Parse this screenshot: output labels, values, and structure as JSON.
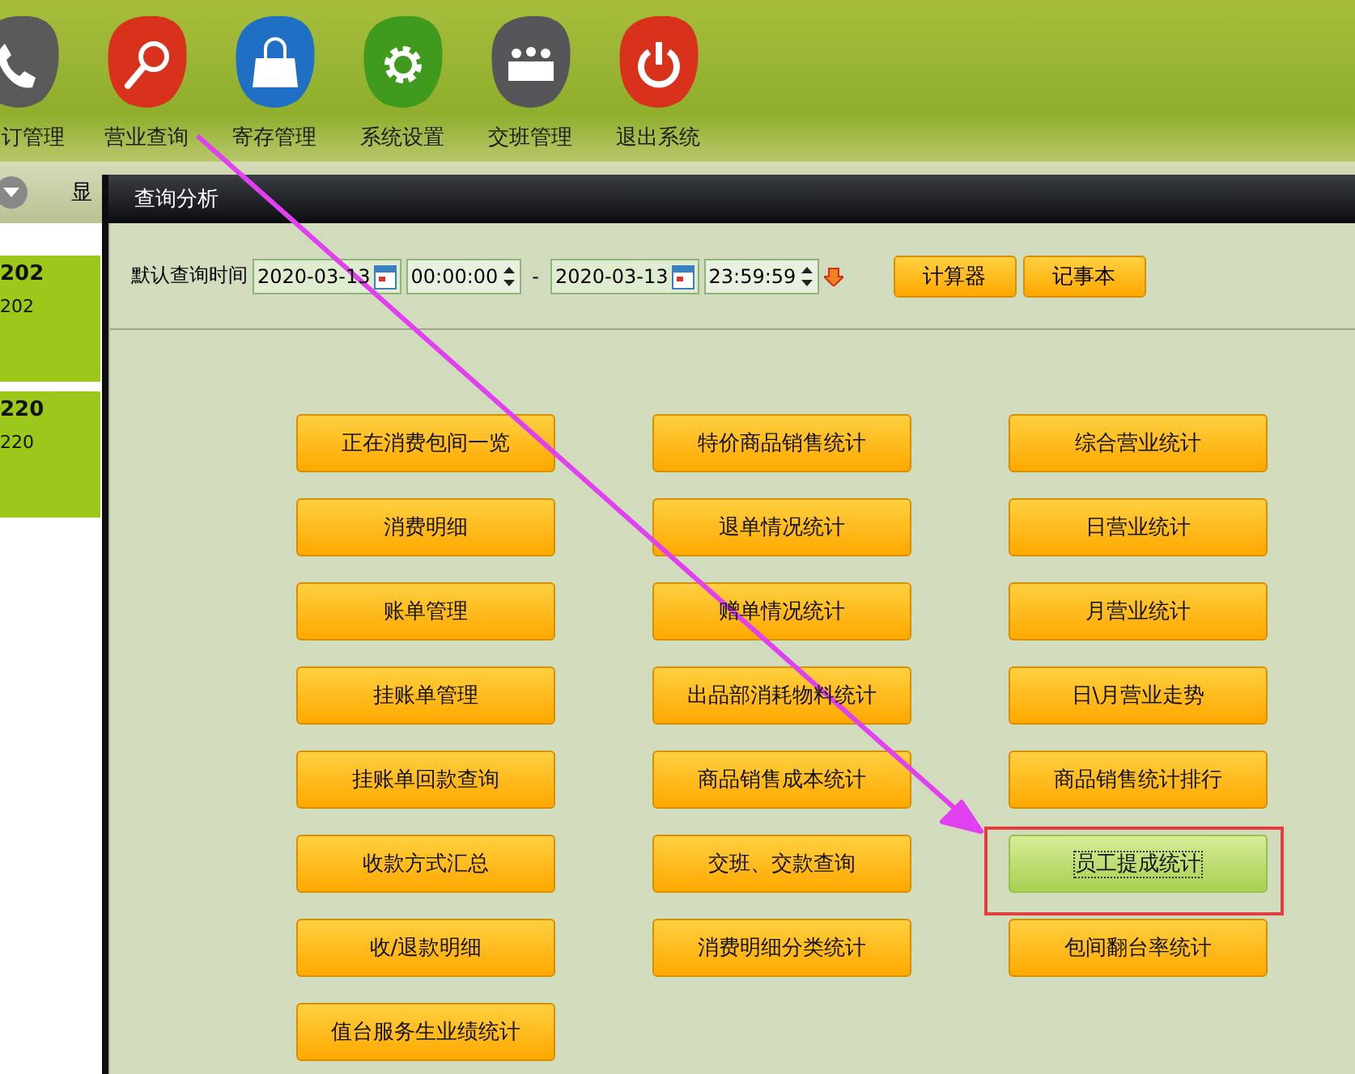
{
  "toolbar": {
    "items": [
      {
        "label": "订管理",
        "kind": "phone",
        "color": "#5a5a5a"
      },
      {
        "label": "营业查询",
        "kind": "search",
        "color": "#d8321c"
      },
      {
        "label": "寄存管理",
        "kind": "bag",
        "color": "#1f6fc4"
      },
      {
        "label": "系统设置",
        "kind": "gear",
        "color": "#3f9a1e"
      },
      {
        "label": "交班管理",
        "kind": "group",
        "color": "#55555a"
      },
      {
        "label": "退出系统",
        "kind": "power",
        "color": "#d8321c"
      }
    ]
  },
  "second_bar": {
    "label": "显"
  },
  "rooms": [
    {
      "number": "202",
      "name": "202"
    },
    {
      "number": "220",
      "name": "220"
    }
  ],
  "dialog": {
    "title": "查询分析",
    "query": {
      "label": "默认查询时间",
      "start_date": "2020-03-13",
      "start_time": "00:00:00",
      "separator": "-",
      "end_date": "2020-03-13",
      "end_time": "23:59:59"
    },
    "tools": [
      "计算器",
      "记事本"
    ],
    "reports": [
      {
        "label": "正在消费包间一览",
        "selected": false
      },
      {
        "label": "特价商品销售统计",
        "selected": false
      },
      {
        "label": "综合营业统计",
        "selected": false
      },
      {
        "label": "消费明细",
        "selected": false
      },
      {
        "label": "退单情况统计",
        "selected": false
      },
      {
        "label": "日营业统计",
        "selected": false
      },
      {
        "label": "账单管理",
        "selected": false
      },
      {
        "label": "赠单情况统计",
        "selected": false
      },
      {
        "label": "月营业统计",
        "selected": false
      },
      {
        "label": "挂账单管理",
        "selected": false
      },
      {
        "label": "出品部消耗物料统计",
        "selected": false
      },
      {
        "label": "日\\月营业走势",
        "selected": false
      },
      {
        "label": "挂账单回款查询",
        "selected": false
      },
      {
        "label": "商品销售成本统计",
        "selected": false
      },
      {
        "label": "商品销售统计排行",
        "selected": false
      },
      {
        "label": "收款方式汇总",
        "selected": false
      },
      {
        "label": "交班、交款查询",
        "selected": false
      },
      {
        "label": "员工提成统计",
        "selected": true
      },
      {
        "label": "收/退款明细",
        "selected": false
      },
      {
        "label": "消费明细分类统计",
        "selected": false
      },
      {
        "label": "包间翻台率统计",
        "selected": false
      },
      {
        "label": "值台服务生业绩统计",
        "selected": false
      }
    ]
  },
  "annotation": {
    "arrow": true,
    "box": true
  }
}
